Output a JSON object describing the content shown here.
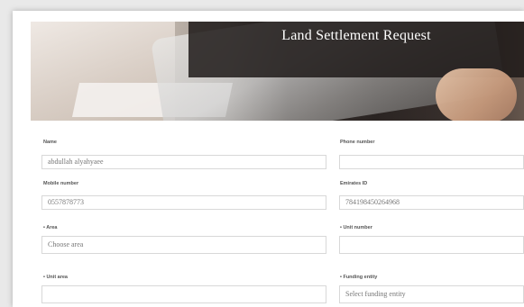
{
  "form": {
    "title": "Land Settlement Request",
    "fields": {
      "name": {
        "label": "Name",
        "value": "abdullah alyahyaee"
      },
      "phone": {
        "label": "Phone number",
        "value": ""
      },
      "mobile": {
        "label": "Mobile number",
        "value": "0557878773"
      },
      "emirates_id": {
        "label": "Emirates ID",
        "value": "784198450264968"
      },
      "area": {
        "label": "• Area",
        "placeholder": "Choose area"
      },
      "unit_number": {
        "label": "• Unit number",
        "value": ""
      },
      "unit_area": {
        "label": "• Unit area",
        "value": ""
      },
      "funding_entity": {
        "label": "• Funding entity",
        "placeholder": "Select funding entity"
      }
    }
  }
}
